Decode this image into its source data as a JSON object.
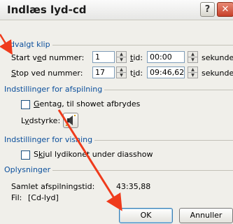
{
  "window": {
    "title": "Indlæs lyd-cd",
    "help_glyph": "?",
    "close_glyph": "✕"
  },
  "clip_group": {
    "label": "Udvalgt klip",
    "start_label_pre": "Start v",
    "start_label_ul": "e",
    "start_label_post": "d nummer:",
    "start_value": "1",
    "start_time_label_pre": "",
    "start_time_label_ul": "t",
    "start_time_label_post": "id:",
    "start_time_value": "00:00",
    "start_unit": "sekunder",
    "stop_label_pre": "",
    "stop_label_ul": "S",
    "stop_label_post": "top ved nummer:",
    "stop_value": "17",
    "stop_time_label_pre": "t",
    "stop_time_label_ul": "i",
    "stop_time_label_post": "d:",
    "stop_time_value": "09:46,62",
    "stop_unit": "sekunder"
  },
  "playback_group": {
    "label": "Indstillinger for afspilning",
    "repeat_label_pre": "",
    "repeat_label_ul": "G",
    "repeat_label_post": "entag, til showet afbrydes",
    "repeat_checked": false,
    "volume_label_pre": "L",
    "volume_label_ul": "y",
    "volume_label_post": "dstyrke:"
  },
  "display_group": {
    "label": "Indstillinger for visning",
    "hide_label_pre": "S",
    "hide_label_ul": "k",
    "hide_label_post": "jul lydikonet under diasshow",
    "hide_checked": false
  },
  "info_group": {
    "label": "Oplysninger",
    "total_label": "Samlet afspilningstid:",
    "total_value": "43:35,88",
    "file_label": "Fil:",
    "file_value": "[Cd-lyd]"
  },
  "buttons": {
    "ok": "OK",
    "cancel": "Annuller"
  },
  "colors": {
    "arrow": "#ef3b1c",
    "group_label": "#0b4f9c",
    "close_button": "#c7402a"
  },
  "icons": {
    "help": "help-icon",
    "close": "close-icon",
    "volume": "speaker-icon",
    "spin_up": "spin-up-icon",
    "spin_down": "spin-down-icon"
  }
}
